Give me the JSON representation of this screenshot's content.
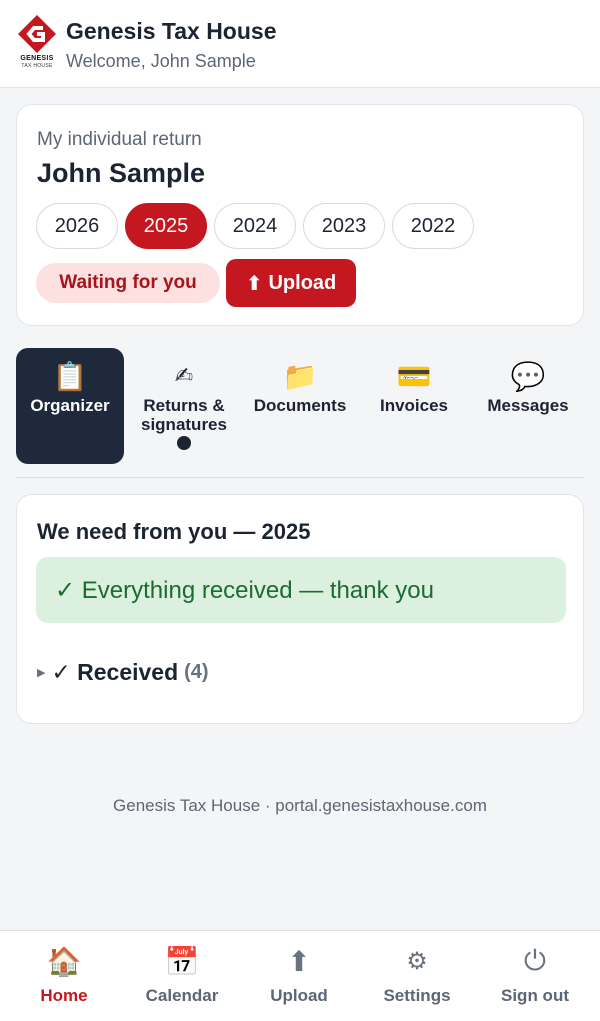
{
  "header": {
    "brand": "Genesis Tax House",
    "welcome": "Welcome, John Sample",
    "logo_word": "GENESIS",
    "logo_sub": "TAX HOUSE"
  },
  "return_card": {
    "label": "My individual return",
    "name": "John Sample",
    "years": [
      "2026",
      "2025",
      "2024",
      "2023",
      "2022"
    ],
    "selected_year": "2025",
    "status": "Waiting for you",
    "upload_label": "Upload",
    "upload_icon": "⬆"
  },
  "tabs": [
    {
      "id": "organizer",
      "label": "Organizer",
      "icon": "clipboard-icon",
      "glyph": "📋"
    },
    {
      "id": "returns",
      "label": "Returns & signatures",
      "icon": "pen-signature-icon",
      "glyph": "✍"
    },
    {
      "id": "documents",
      "label": "Documents",
      "icon": "folder-icon",
      "glyph": "📁"
    },
    {
      "id": "invoices",
      "label": "Invoices",
      "icon": "credit-card-icon",
      "glyph": "💳"
    },
    {
      "id": "messages",
      "label": "Messages",
      "icon": "speech-bubble-icon",
      "glyph": "💬"
    }
  ],
  "needs": {
    "title": "We need from you — 2025",
    "success_message": "✓ Everything received — thank you",
    "received_label": "✓ Received",
    "received_count": "(4)"
  },
  "footer": "Genesis Tax House · portal.genesistaxhouse.com",
  "bottom_nav": [
    {
      "id": "home",
      "label": "Home",
      "icon": "house-icon",
      "glyph": "🏠"
    },
    {
      "id": "calendar",
      "label": "Calendar",
      "icon": "calendar-icon",
      "glyph": "📅"
    },
    {
      "id": "upload",
      "label": "Upload",
      "icon": "up-arrow-icon",
      "glyph": "⬆"
    },
    {
      "id": "settings",
      "label": "Settings",
      "icon": "gear-icon",
      "glyph": "⚙"
    },
    {
      "id": "signout",
      "label": "Sign out",
      "icon": "power-icon",
      "glyph": "⏻"
    }
  ],
  "colors": {
    "brand_red": "#c4171f",
    "active_tab": "#1e2a3b",
    "success_bg": "#dcf0df",
    "badge_bg": "#fde0e0"
  }
}
